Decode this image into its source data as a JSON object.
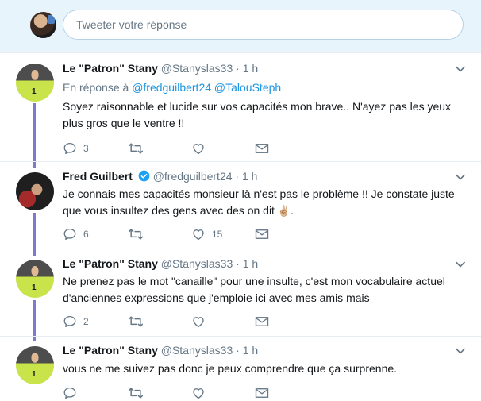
{
  "compose": {
    "placeholder": "Tweeter votre réponse"
  },
  "tweets": [
    {
      "name": "Le \"Patron\" Stany",
      "handle": "@Stanyslas33",
      "separator": "·",
      "time": "1 h",
      "replying_prefix": "En réponse à",
      "replying_to": [
        "@fredguilbert24",
        "@TalouSteph"
      ],
      "text": "Soyez raisonnable et lucide sur vos capacités mon brave.. N'ayez pas les yeux plus gros que le ventre !!",
      "replies": "3",
      "retweets": "",
      "likes": ""
    },
    {
      "name": "Fred Guilbert",
      "verified": true,
      "handle": "@fredguilbert24",
      "separator": "·",
      "time": "1 h",
      "text": "Je connais mes capacités monsieur là n'est pas le problème  !!    Je constate juste que vous insultez des gens avec des on dit",
      "emoji": "✌🏼",
      "text_end": ".",
      "replies": "6",
      "retweets": "",
      "likes": "15"
    },
    {
      "name": "Le \"Patron\" Stany",
      "handle": "@Stanyslas33",
      "separator": "·",
      "time": "1 h",
      "text": "Ne prenez pas le mot \"canaille\" pour une insulte, c'est mon vocabulaire actuel d'anciennes expressions que j'emploie ici avec mes amis mais",
      "replies": "2",
      "retweets": "",
      "likes": ""
    },
    {
      "name": "Le \"Patron\" Stany",
      "handle": "@Stanyslas33",
      "separator": "·",
      "time": "1 h",
      "text": "vous ne me suivez pas donc je peux comprendre que ça surprenne.",
      "replies": "",
      "retweets": "",
      "likes": ""
    }
  ],
  "colors": {
    "compose_background": "#e8f4fb",
    "link": "#1b95e0",
    "thread_line": "#7c7ccb",
    "muted_text": "#657786",
    "verified_badge": "#1da1f2"
  },
  "icons": [
    "reply-icon",
    "retweet-icon",
    "like-icon",
    "direct-message-icon",
    "chevron-down-icon",
    "verified-badge-icon"
  ]
}
